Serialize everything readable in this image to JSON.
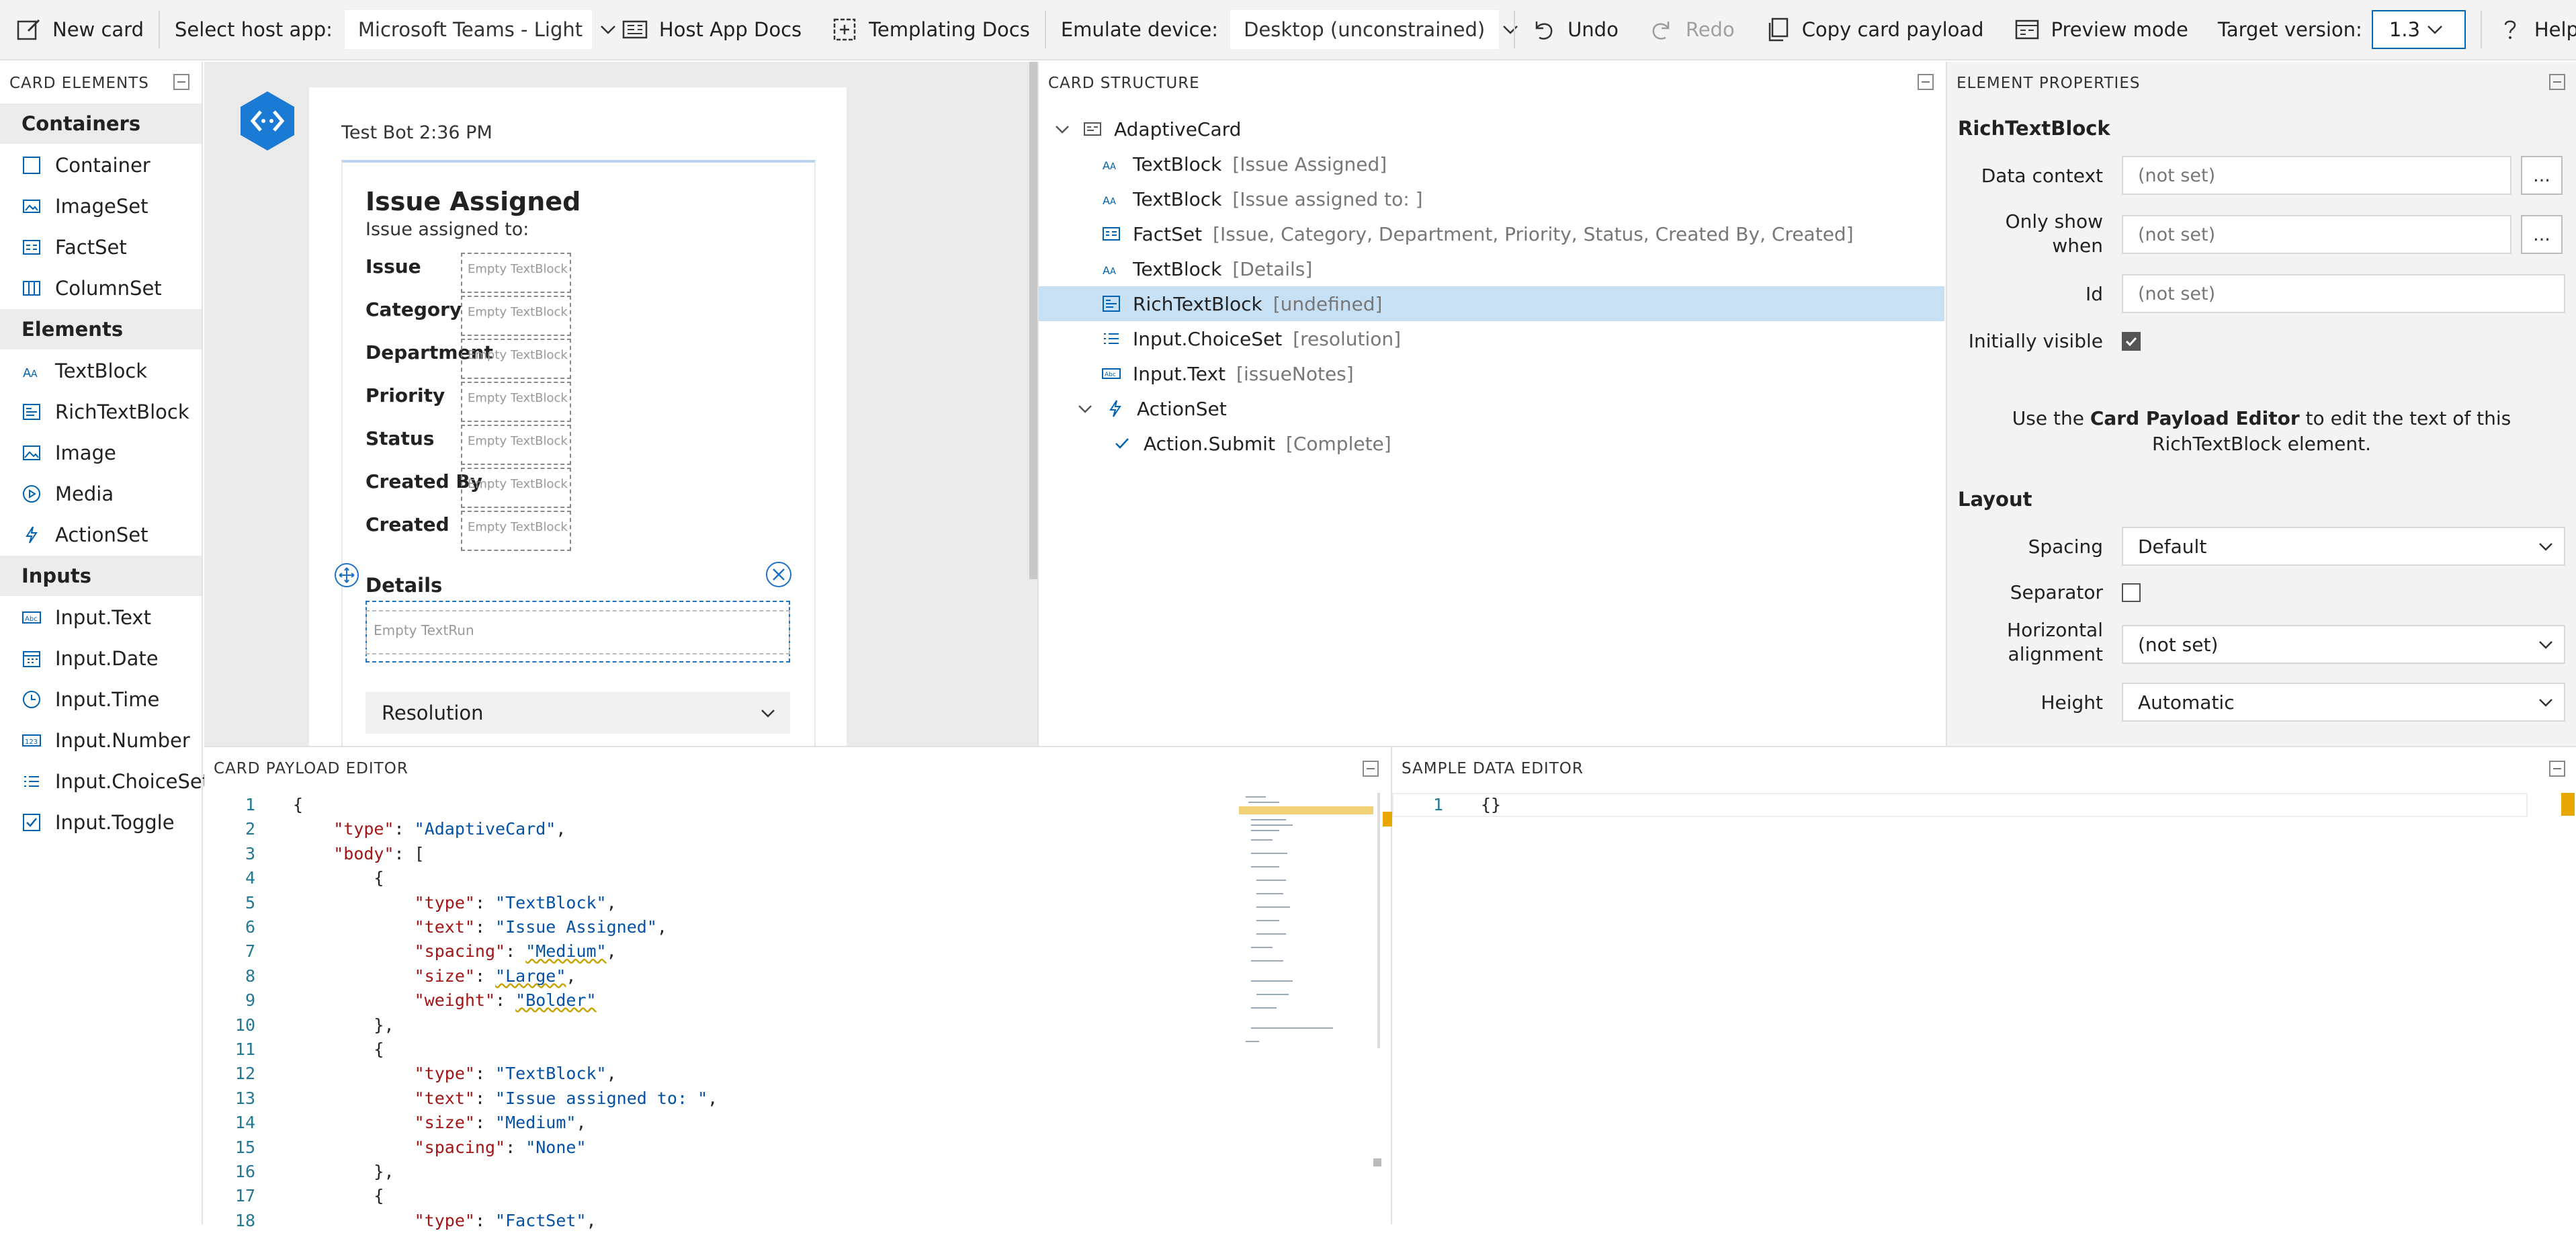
{
  "toolbar": {
    "new_card": "New card",
    "host_app_label": "Select host app:",
    "host_app_value": "Microsoft Teams - Light",
    "host_app_docs": "Host App Docs",
    "templating_docs": "Templating Docs",
    "emulate_label": "Emulate device:",
    "emulate_value": "Desktop (unconstrained)",
    "undo": "Undo",
    "redo": "Redo",
    "copy_payload": "Copy card payload",
    "preview_mode": "Preview mode",
    "target_label": "Target version:",
    "target_value": "1.3",
    "help": "Help"
  },
  "palette": {
    "title": "CARD ELEMENTS",
    "categories": [
      {
        "name": "Containers",
        "items": [
          "Container",
          "ImageSet",
          "FactSet",
          "ColumnSet"
        ]
      },
      {
        "name": "Elements",
        "items": [
          "TextBlock",
          "RichTextBlock",
          "Image",
          "Media",
          "ActionSet"
        ]
      },
      {
        "name": "Inputs",
        "items": [
          "Input.Text",
          "Input.Date",
          "Input.Time",
          "Input.Number",
          "Input.ChoiceSet",
          "Input.Toggle"
        ]
      }
    ]
  },
  "preview": {
    "bot_line": "Test Bot 2:36 PM",
    "card_title": "Issue Assigned",
    "card_subtitle": "Issue assigned to:",
    "facts": [
      "Issue",
      "Category",
      "Department",
      "Priority",
      "Status",
      "Created By",
      "Created"
    ],
    "empty_textblock": "Empty TextBlock",
    "details": "Details",
    "empty_textrun": "Empty TextRun",
    "resolution": "Resolution"
  },
  "structure": {
    "title": "CARD STRUCTURE",
    "rows": [
      {
        "name": "AdaptiveCard",
        "summary": ""
      },
      {
        "name": "TextBlock",
        "summary": "[Issue Assigned]"
      },
      {
        "name": "TextBlock",
        "summary": "[Issue assigned to: ]"
      },
      {
        "name": "FactSet",
        "summary": "[Issue, Category, Department, Priority, Status, Created By, Created]"
      },
      {
        "name": "TextBlock",
        "summary": "[Details]"
      },
      {
        "name": "RichTextBlock",
        "summary": "[undefined]"
      },
      {
        "name": "Input.ChoiceSet",
        "summary": "[resolution]"
      },
      {
        "name": "Input.Text",
        "summary": "[issueNotes]"
      },
      {
        "name": "ActionSet",
        "summary": ""
      },
      {
        "name": "Action.Submit",
        "summary": "[Complete]"
      }
    ]
  },
  "properties": {
    "title": "ELEMENT PROPERTIES",
    "element": "RichTextBlock",
    "data_context_label": "Data context",
    "not_set": "(not set)",
    "only_show_label": "Only show\nwhen",
    "id_label": "Id",
    "initially_visible_label": "Initially visible",
    "more": "...",
    "hint_pre": "Use the ",
    "hint_bold": "Card Payload Editor",
    "hint_post": " to edit the text of this RichTextBlock element.",
    "layout_title": "Layout",
    "spacing_label": "Spacing",
    "spacing_value": "Default",
    "separator_label": "Separator",
    "halign_label": "Horizontal\nalignment",
    "halign_value": "(not set)",
    "height_label": "Height",
    "height_value": "Automatic"
  },
  "payload_editor": {
    "title": "CARD PAYLOAD EDITOR",
    "lines": [
      [
        [
          "p",
          "{"
        ]
      ],
      [
        [
          "p",
          "    "
        ],
        [
          "k",
          "\"type\""
        ],
        [
          "p",
          ": "
        ],
        [
          "s",
          "\"AdaptiveCard\""
        ],
        [
          "p",
          ","
        ]
      ],
      [
        [
          "p",
          "    "
        ],
        [
          "k",
          "\"body\""
        ],
        [
          "p",
          ": ["
        ]
      ],
      [
        [
          "p",
          "        {"
        ]
      ],
      [
        [
          "p",
          "            "
        ],
        [
          "k",
          "\"type\""
        ],
        [
          "p",
          ": "
        ],
        [
          "s",
          "\"TextBlock\""
        ],
        [
          "p",
          ","
        ]
      ],
      [
        [
          "p",
          "            "
        ],
        [
          "k",
          "\"text\""
        ],
        [
          "p",
          ": "
        ],
        [
          "s",
          "\"Issue Assigned\""
        ],
        [
          "p",
          ","
        ]
      ],
      [
        [
          "p",
          "            "
        ],
        [
          "k",
          "\"spacing\""
        ],
        [
          "p",
          ": "
        ],
        [
          "sq",
          "\"Medium\""
        ],
        [
          "p",
          ","
        ]
      ],
      [
        [
          "p",
          "            "
        ],
        [
          "k",
          "\"size\""
        ],
        [
          "p",
          ": "
        ],
        [
          "sq",
          "\"Large\""
        ],
        [
          "p",
          ","
        ]
      ],
      [
        [
          "p",
          "            "
        ],
        [
          "k",
          "\"weight\""
        ],
        [
          "p",
          ": "
        ],
        [
          "sq",
          "\"Bolder\""
        ]
      ],
      [
        [
          "p",
          "        },"
        ]
      ],
      [
        [
          "p",
          "        {"
        ]
      ],
      [
        [
          "p",
          "            "
        ],
        [
          "k",
          "\"type\""
        ],
        [
          "p",
          ": "
        ],
        [
          "s",
          "\"TextBlock\""
        ],
        [
          "p",
          ","
        ]
      ],
      [
        [
          "p",
          "            "
        ],
        [
          "k",
          "\"text\""
        ],
        [
          "p",
          ": "
        ],
        [
          "s",
          "\"Issue assigned to: \""
        ],
        [
          "p",
          ","
        ]
      ],
      [
        [
          "p",
          "            "
        ],
        [
          "k",
          "\"size\""
        ],
        [
          "p",
          ": "
        ],
        [
          "s",
          "\"Medium\""
        ],
        [
          "p",
          ","
        ]
      ],
      [
        [
          "p",
          "            "
        ],
        [
          "k",
          "\"spacing\""
        ],
        [
          "p",
          ": "
        ],
        [
          "s",
          "\"None\""
        ]
      ],
      [
        [
          "p",
          "        },"
        ]
      ],
      [
        [
          "p",
          "        {"
        ]
      ],
      [
        [
          "p",
          "            "
        ],
        [
          "k",
          "\"type\""
        ],
        [
          "p",
          ": "
        ],
        [
          "s",
          "\"FactSet\""
        ],
        [
          "p",
          ","
        ]
      ]
    ]
  },
  "sample_editor": {
    "title": "SAMPLE DATA EDITOR",
    "lines": [
      [
        [
          "p",
          "{}"
        ]
      ]
    ]
  },
  "colors": {
    "accent": "#0063b1",
    "selection": "#c7e0f4",
    "json_key": "#a31515",
    "json_string": "#0451a5",
    "line_number": "#237893"
  }
}
